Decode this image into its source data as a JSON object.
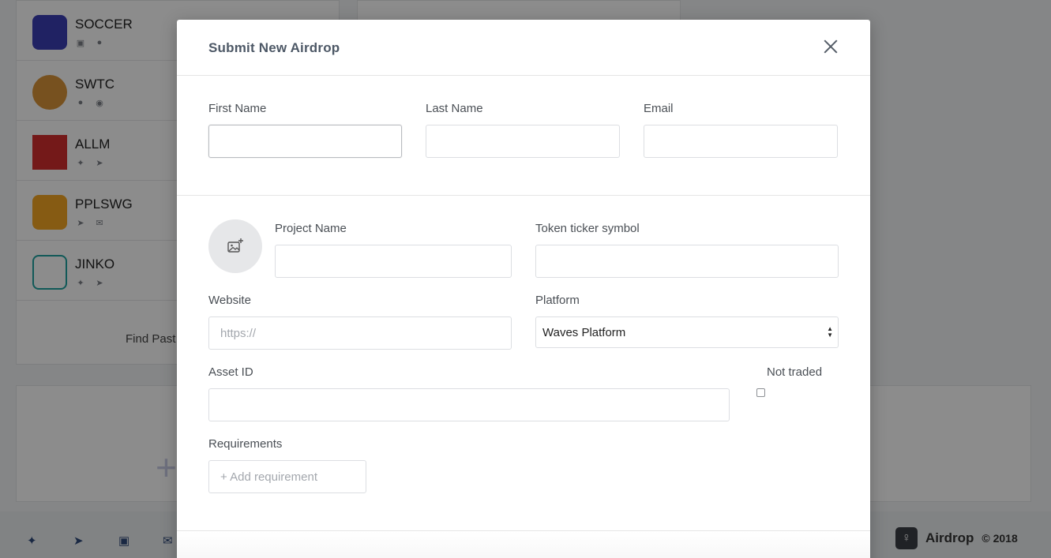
{
  "background": {
    "coins": [
      {
        "name": "SOCCER",
        "icons": [
          "facebook-icon",
          "user-icon"
        ],
        "logo_color": "#3b3fb5"
      },
      {
        "name": "SWTC",
        "icons": [
          "user-icon",
          "globe-icon"
        ],
        "logo_color": "#d9943a"
      },
      {
        "name": "ALLM",
        "icons": [
          "twitter-icon",
          "telegram-icon"
        ],
        "logo_color": "#d32f2f"
      },
      {
        "name": "PPLSWG",
        "icons": [
          "telegram-icon",
          "mail-icon"
        ],
        "logo_color": "#f5a623"
      },
      {
        "name": "JINKO",
        "icons": [
          "twitter-icon",
          "telegram-icon"
        ],
        "logo_color": "#1fa3a0"
      }
    ],
    "find_past": "Find Past",
    "footer": {
      "brand": "Airdrop",
      "copyright": "© 2018",
      "social_icons": [
        "twitter-icon",
        "telegram-icon",
        "facebook-icon",
        "mail-icon"
      ]
    }
  },
  "modal": {
    "title": "Submit New Airdrop",
    "first_name": {
      "label": "First Name",
      "value": "",
      "placeholder": ""
    },
    "last_name": {
      "label": "Last Name",
      "value": "",
      "placeholder": ""
    },
    "email": {
      "label": "Email",
      "value": "",
      "placeholder": ""
    },
    "project_name": {
      "label": "Project Name",
      "value": "",
      "placeholder": ""
    },
    "token_ticker": {
      "label": "Token ticker symbol",
      "value": "",
      "placeholder": ""
    },
    "website": {
      "label": "Website",
      "value": "",
      "placeholder": "https://"
    },
    "platform": {
      "label": "Platform",
      "selected": "Waves Platform"
    },
    "asset_id": {
      "label": "Asset ID",
      "value": "",
      "placeholder": ""
    },
    "not_traded": {
      "label": "Not traded",
      "checked": false
    },
    "requirements": {
      "label": "Requirements",
      "placeholder": "+ Add requirement"
    }
  }
}
